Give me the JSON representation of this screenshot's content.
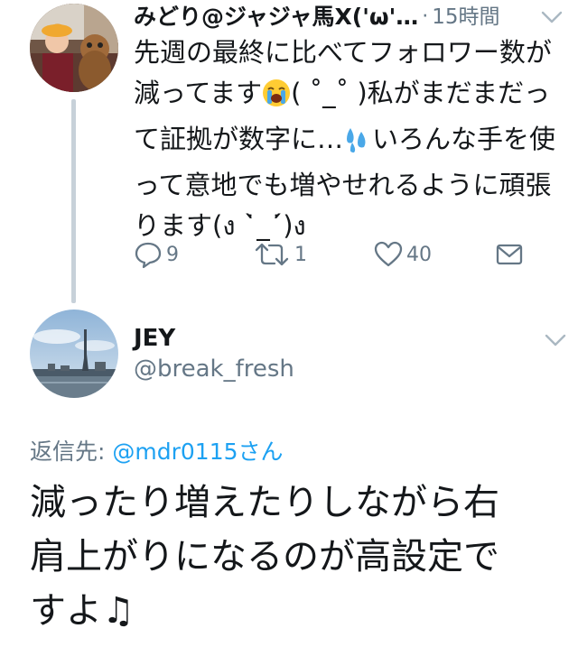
{
  "parent_tweet": {
    "author_name": "みどり@ジャジャ馬X('ω'…",
    "separator": "·",
    "time": "15時間",
    "text_lines": [
      "先週の最終に比べてフォロワー数が",
      "減ってます",
      "( ˚_˚ )私がまだまだっ",
      "て証拠が数字に…",
      "いろんな手を使",
      "って意地でも増やせれるように頑張",
      "ります(ง ˙̀_˙́)ง"
    ],
    "emoji": {
      "crying": "crying-face-icon",
      "sweat": "sweat-droplets-icon"
    },
    "actions": {
      "reply_count": "9",
      "retweet_count": "1",
      "like_count": "40"
    }
  },
  "reply_tweet": {
    "author_name": "JEY",
    "handle": "@break_fresh",
    "reply_to_label": "返信先:",
    "reply_to_mention": "@mdr0115さん",
    "text_lines": [
      "減ったり増えたりしながら右",
      "肩上がりになるのが高設定で",
      "すよ♫"
    ]
  },
  "colors": {
    "text": "#14171a",
    "secondary": "#657786",
    "link": "#1da1f2",
    "thread_line": "#c7d1d9"
  }
}
